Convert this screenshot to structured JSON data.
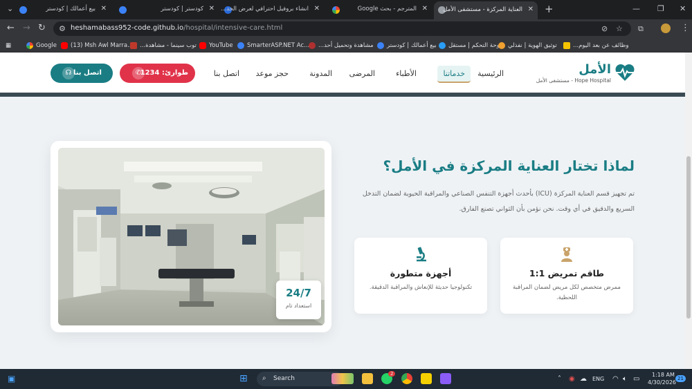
{
  "browser": {
    "tabs": [
      {
        "title": "بيع أعمالك | كودستر",
        "active": false
      },
      {
        "title": "كودستر | كودستر",
        "active": false
      },
      {
        "title": "انشاء بروفيل احترافي لعرض الخد...",
        "active": false
      },
      {
        "title": "المترجم - بحث Google",
        "active": false
      },
      {
        "title": "العناية المركزة - مستشفى الأمل",
        "active": true
      }
    ],
    "new_tab": "+",
    "url_host": "heshamabass952-code.github.io",
    "url_path": "/hospital/intensive-care.html",
    "bookmarks": [
      {
        "label": "Google",
        "color": "#4285f4"
      },
      {
        "label": "(13) Msh Awl Marra...",
        "color": "#ff0000"
      },
      {
        "label": "توب سينما - مشاهدة...",
        "color": "#c0392b"
      },
      {
        "label": "YouTube",
        "color": "#ff0000"
      },
      {
        "label": "SmarterASP.NET Ac...",
        "color": "#3b82f6"
      },
      {
        "label": "مشاهدة وتحميل أحد...",
        "color": "#b03030"
      },
      {
        "label": "بيع أعمالك | كودستر",
        "color": "#3b82f6"
      },
      {
        "label": "لوحة التحكم | مستقل",
        "color": "#2a9df4"
      },
      {
        "label": "توثيق الهوية | نفذلي",
        "color": "#f0a030"
      },
      {
        "label": "وظائف عن بعد اليوم...",
        "color": "#f5c400"
      }
    ]
  },
  "site": {
    "logo_name": "الأمل",
    "logo_sub": "Hope Hospital - مستشفى الأمل",
    "nav": {
      "home": "الرئيسية",
      "services": "خدماتنا",
      "doctors": "الأطباء",
      "patients": "المرضى",
      "blog": "المدونة",
      "booking": "حجز موعد",
      "contact": "اتصل بنا"
    },
    "emergency_button": "طوارئ: 1234",
    "contact_button": "اتصل بنا"
  },
  "content": {
    "title": "لماذا تختار العناية المركزة في الأمل؟",
    "description": "تم تجهيز قسم العناية المركزة (ICU) بأحدث أجهزة التنفس الصناعي والمراقبة الحيوية لضمان التدخل السريع والدقيق في أي وقت. نحن نؤمن بأن الثواني تصنع الفارق.",
    "cards": [
      {
        "title": "طاقم تمريض 1:1",
        "desc": "ممرض متخصص لكل مريض لضمان المراقبة اللحظية."
      },
      {
        "title": "أجهزة متطورة",
        "desc": "تكنولوجيا حديثة للإنعاش والمراقبة الدقيقة."
      }
    ],
    "badge_big": "24/7",
    "badge_small": "استعداد تام"
  },
  "taskbar": {
    "search": "Search",
    "lang": "ENG",
    "time": "1:18 AM",
    "date": "4/30/2026",
    "notif_count": "21",
    "whatsapp_count": "2"
  },
  "colors": {
    "brand": "#1a7d84",
    "emergency": "#e0334a",
    "accent": "#c9a36a"
  }
}
